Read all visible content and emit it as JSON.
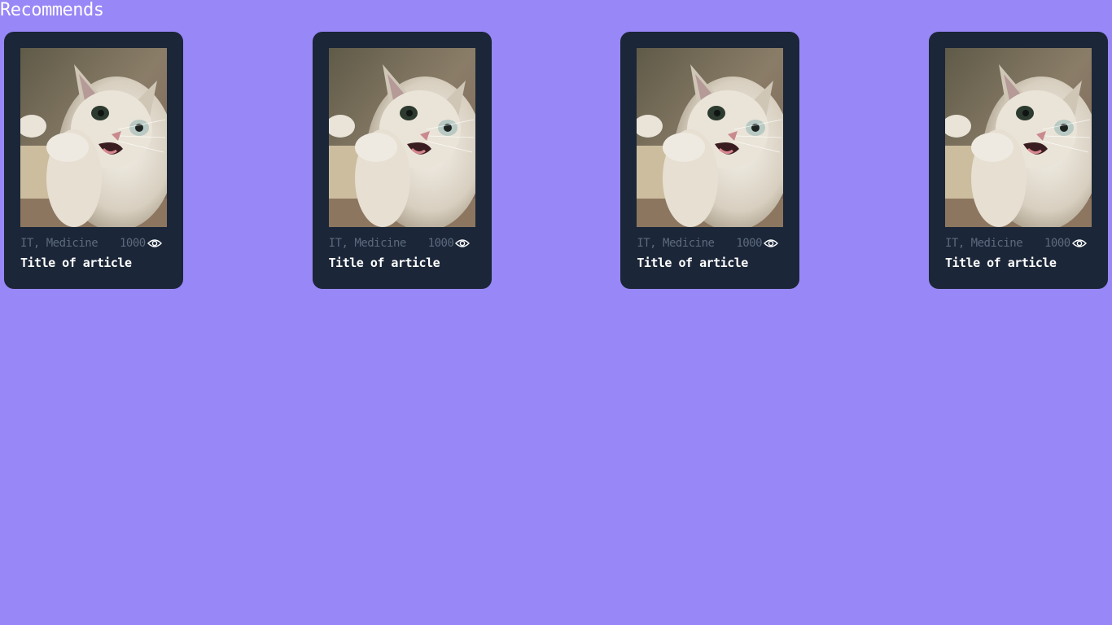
{
  "section": {
    "title": "Recommends"
  },
  "cards": [
    {
      "tags": "IT, Medicine",
      "views": "1000",
      "title": "Title of article",
      "image_icon": "cat-photo"
    },
    {
      "tags": "IT, Medicine",
      "views": "1000",
      "title": "Title of article",
      "image_icon": "cat-photo"
    },
    {
      "tags": "IT, Medicine",
      "views": "1000",
      "title": "Title of article",
      "image_icon": "cat-photo"
    },
    {
      "tags": "IT, Medicine",
      "views": "1000",
      "title": "Title of article",
      "image_icon": "cat-photo"
    }
  ],
  "icons": {
    "views": "eye-icon"
  },
  "colors": {
    "background": "#9887f6",
    "card": "#1b2638",
    "meta_text": "#5d6a7e",
    "title_text": "#ffffff"
  }
}
